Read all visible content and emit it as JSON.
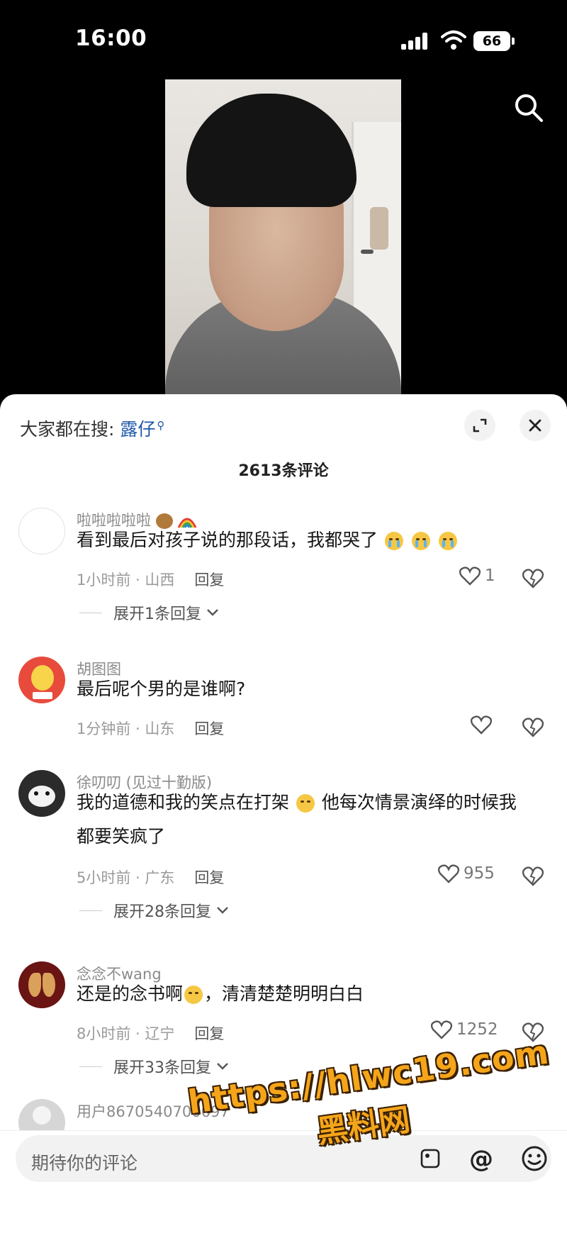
{
  "status_bar": {
    "time": "16:00",
    "battery": "66"
  },
  "video": {
    "search_icon": "search-icon"
  },
  "sheet": {
    "hot_search_prefix": "大家都在搜:",
    "hot_search_keyword": "露仔",
    "comment_count": "2613条评论"
  },
  "comments": [
    {
      "username": "啦啦啦啦啦",
      "text": "看到最后对孩子说的那段话，我都哭了",
      "time_region": "1小时前 · 山西",
      "reply_label": "回复",
      "likes": "1",
      "expand_label": "展开1条回复"
    },
    {
      "username": "胡图图",
      "text": "最后呢个男的是谁啊?",
      "time_region": "1分钟前 · 山东",
      "reply_label": "回复",
      "likes": ""
    },
    {
      "username": "徐叨叨 (见过十勤版)",
      "text_line1": "我的道德和我的笑点在打架",
      "text_line1b": "他每次情景演绎的时候我",
      "text_line2": "都要笑疯了",
      "time_region": "5小时前 · 广东",
      "reply_label": "回复",
      "likes": "955",
      "expand_label": "展开28条回复"
    },
    {
      "username": "念念不wang",
      "text_a": "还是的念书啊",
      "text_b": "，清清楚楚明明白白",
      "time_region": "8小时前 · 辽宁",
      "reply_label": "回复",
      "likes": "1252",
      "expand_label": "展开33条回复"
    },
    {
      "username": "用户8670540700697"
    }
  ],
  "input_bar": {
    "placeholder": "期待你的评论",
    "at_label": "@"
  },
  "watermark": {
    "url": "https://hlwc19.com",
    "name": "黑料网"
  },
  "colors": {
    "link_blue": "#1f57a8",
    "watermark_orange": "#f5a51a"
  }
}
